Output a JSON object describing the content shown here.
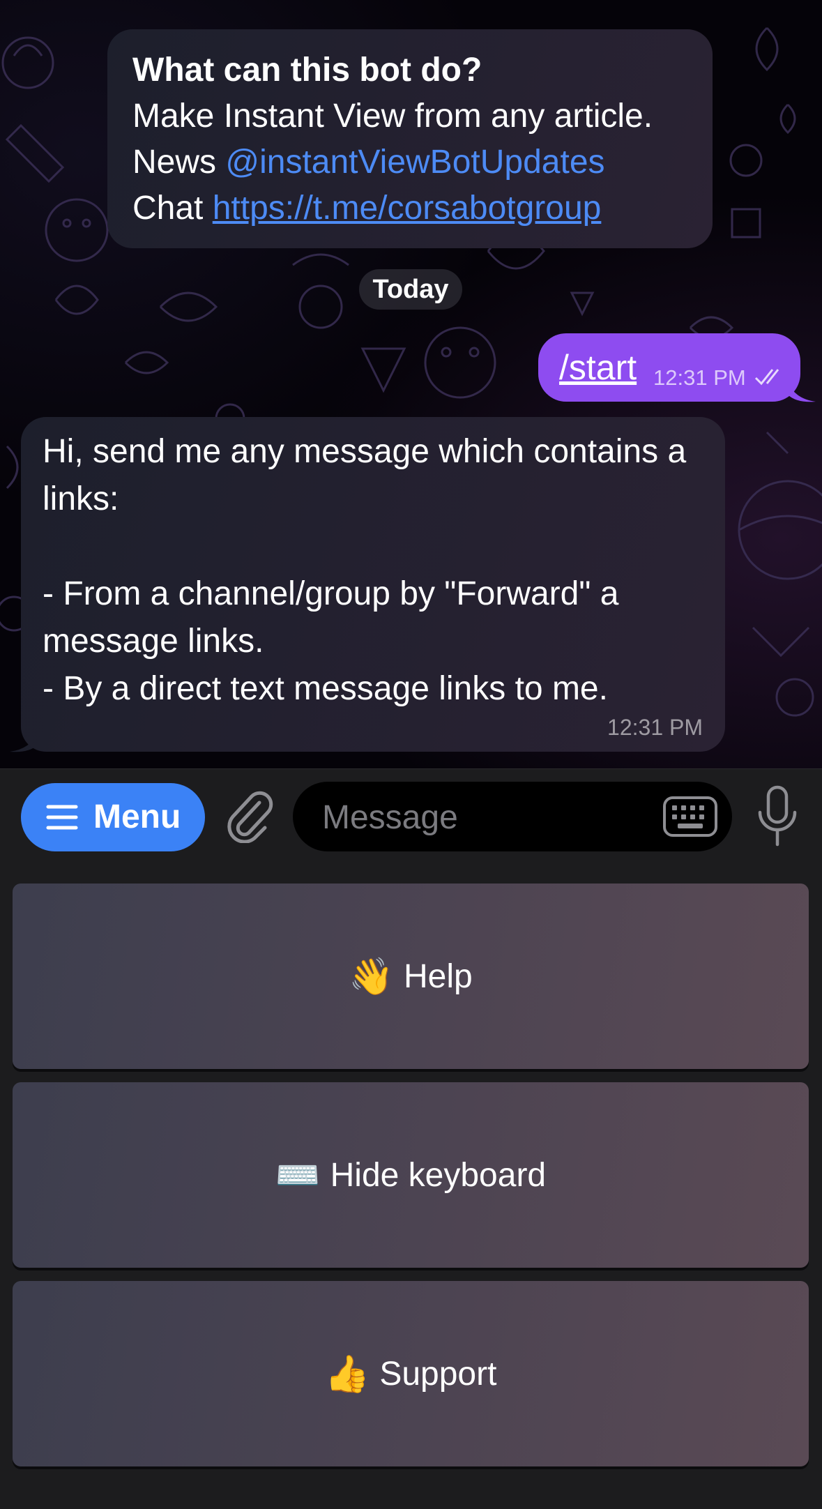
{
  "bot_info": {
    "title": "What can this bot do?",
    "line1": "Make Instant View from any article.",
    "news_label": "News ",
    "news_handle": "@instantViewBotUpdates",
    "chat_label": "Chat ",
    "chat_link": "https://t.me/corsabotgroup"
  },
  "date_divider": "Today",
  "outgoing": {
    "text": "/start",
    "time": "12:31 PM",
    "status_icon": "double-check-icon"
  },
  "incoming": {
    "text": "Hi, send me any message which contains a links:\n\n- From a channel/group by \"Forward\" a message links.\n- By a direct text message links to me.",
    "time": "12:31 PM"
  },
  "input_bar": {
    "menu_label": "Menu",
    "placeholder": "Message",
    "icons": [
      "menu-lines-icon",
      "paperclip-icon",
      "keyboard-icon",
      "microphone-icon"
    ]
  },
  "reply_keyboard": [
    {
      "emoji": "👋",
      "label": "Help"
    },
    {
      "emoji": "⌨️",
      "label": "Hide keyboard"
    },
    {
      "emoji": "👍",
      "label": "Support"
    }
  ],
  "colors": {
    "accent_blue": "#3b82f6",
    "link_blue": "#4d8bf5",
    "outgoing_bubble": "#8e4cf0",
    "incoming_bubble": "#1d1f2c"
  }
}
